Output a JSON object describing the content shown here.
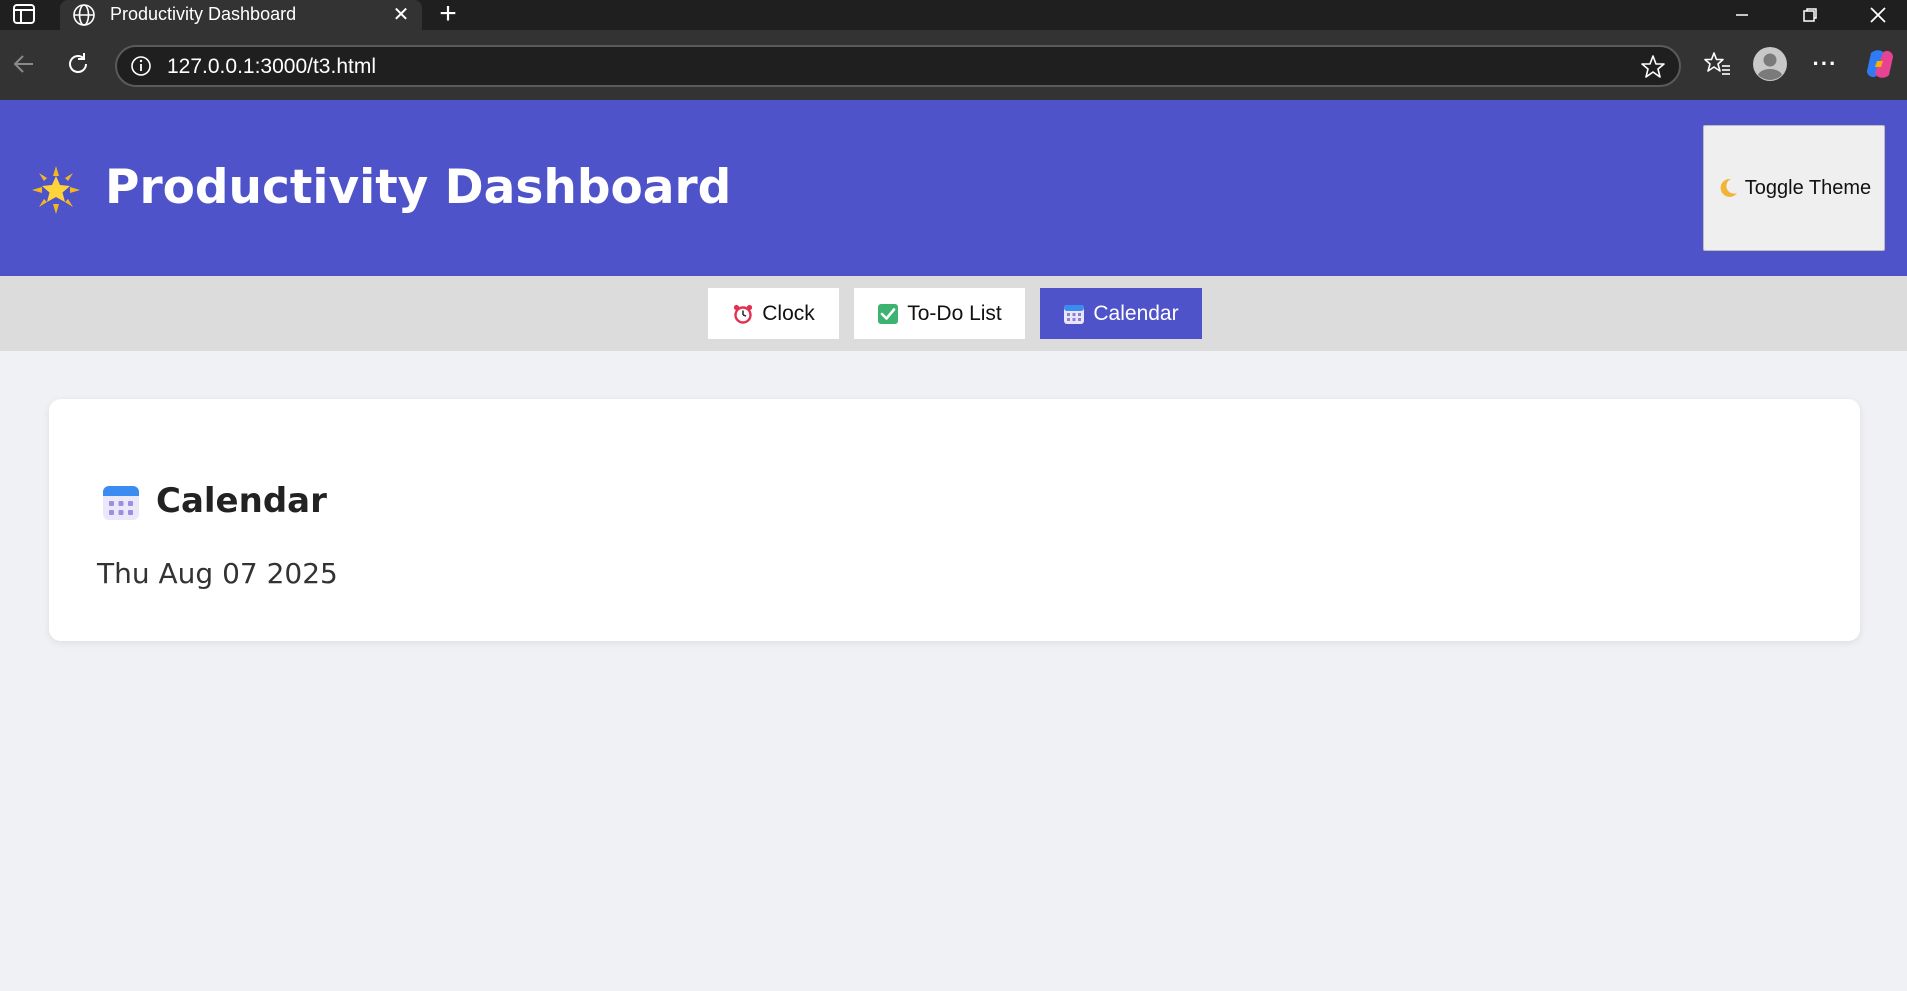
{
  "browser": {
    "tab_title": "Productivity Dashboard",
    "url": "127.0.0.1:3000/t3.html",
    "icons": [
      "sidebar-icon",
      "globe-icon",
      "close-icon",
      "plus-icon",
      "minimize-icon",
      "restore-icon",
      "window-close-icon",
      "back-icon",
      "reload-icon",
      "info-icon",
      "star-icon",
      "favorites-icon",
      "profile-icon",
      "more-icon",
      "copilot-icon"
    ]
  },
  "header": {
    "emoji_icon": "star-icon",
    "title": "Productivity Dashboard",
    "toggle_label": "Toggle Theme",
    "toggle_icon": "moon-icon",
    "bg_color": "#4f53c9"
  },
  "nav": {
    "tabs": [
      {
        "label": "Clock",
        "icon": "alarm-clock-icon",
        "active": false
      },
      {
        "label": "To-Do List",
        "icon": "check-box-icon",
        "active": false
      },
      {
        "label": "Calendar",
        "icon": "calendar-icon",
        "active": true
      }
    ],
    "active_color": "#4f53c9"
  },
  "card": {
    "title": "Calendar",
    "icon": "calendar-icon",
    "date": "Thu Aug 07 2025"
  }
}
